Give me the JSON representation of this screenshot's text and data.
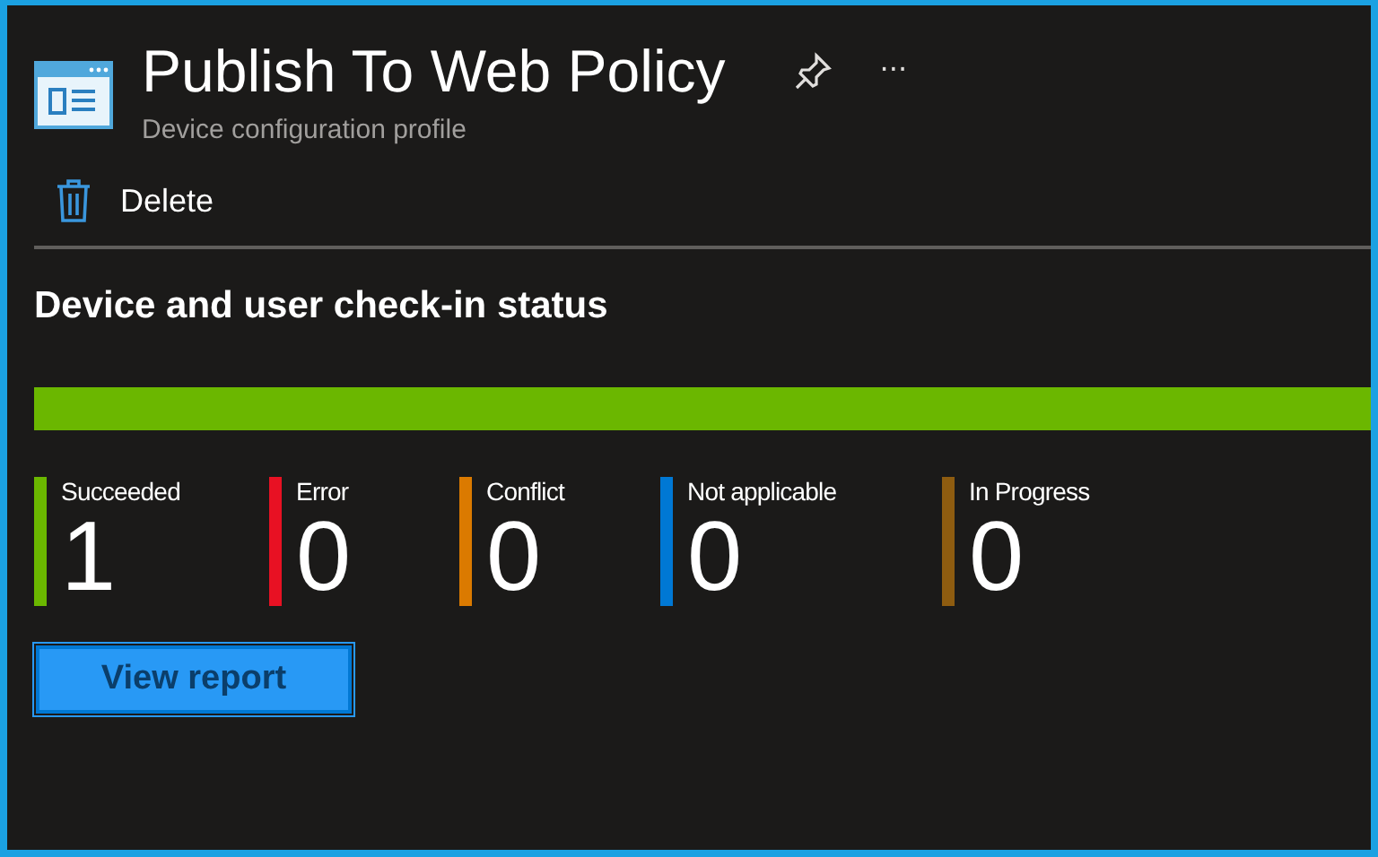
{
  "header": {
    "title": "Publish To Web Policy",
    "subtitle": "Device configuration profile",
    "more": "···"
  },
  "toolbar": [
    {
      "label": "Delete",
      "kind": "delete"
    }
  ],
  "status": {
    "heading": "Device and user check-in status",
    "level": 1,
    "stats": [
      {
        "label": "Succeeded",
        "count": "1",
        "color": "#6bb700"
      },
      {
        "label": "Error",
        "count": "0",
        "color": "#e81123"
      },
      {
        "label": "Conflict",
        "count": "0",
        "color": "#db7a00"
      },
      {
        "label": "Not applicable",
        "count": "0",
        "color": "#0078d4"
      },
      {
        "label": "In Progress",
        "count": "0",
        "color": "#8e5c10"
      }
    ],
    "button": "View report"
  }
}
